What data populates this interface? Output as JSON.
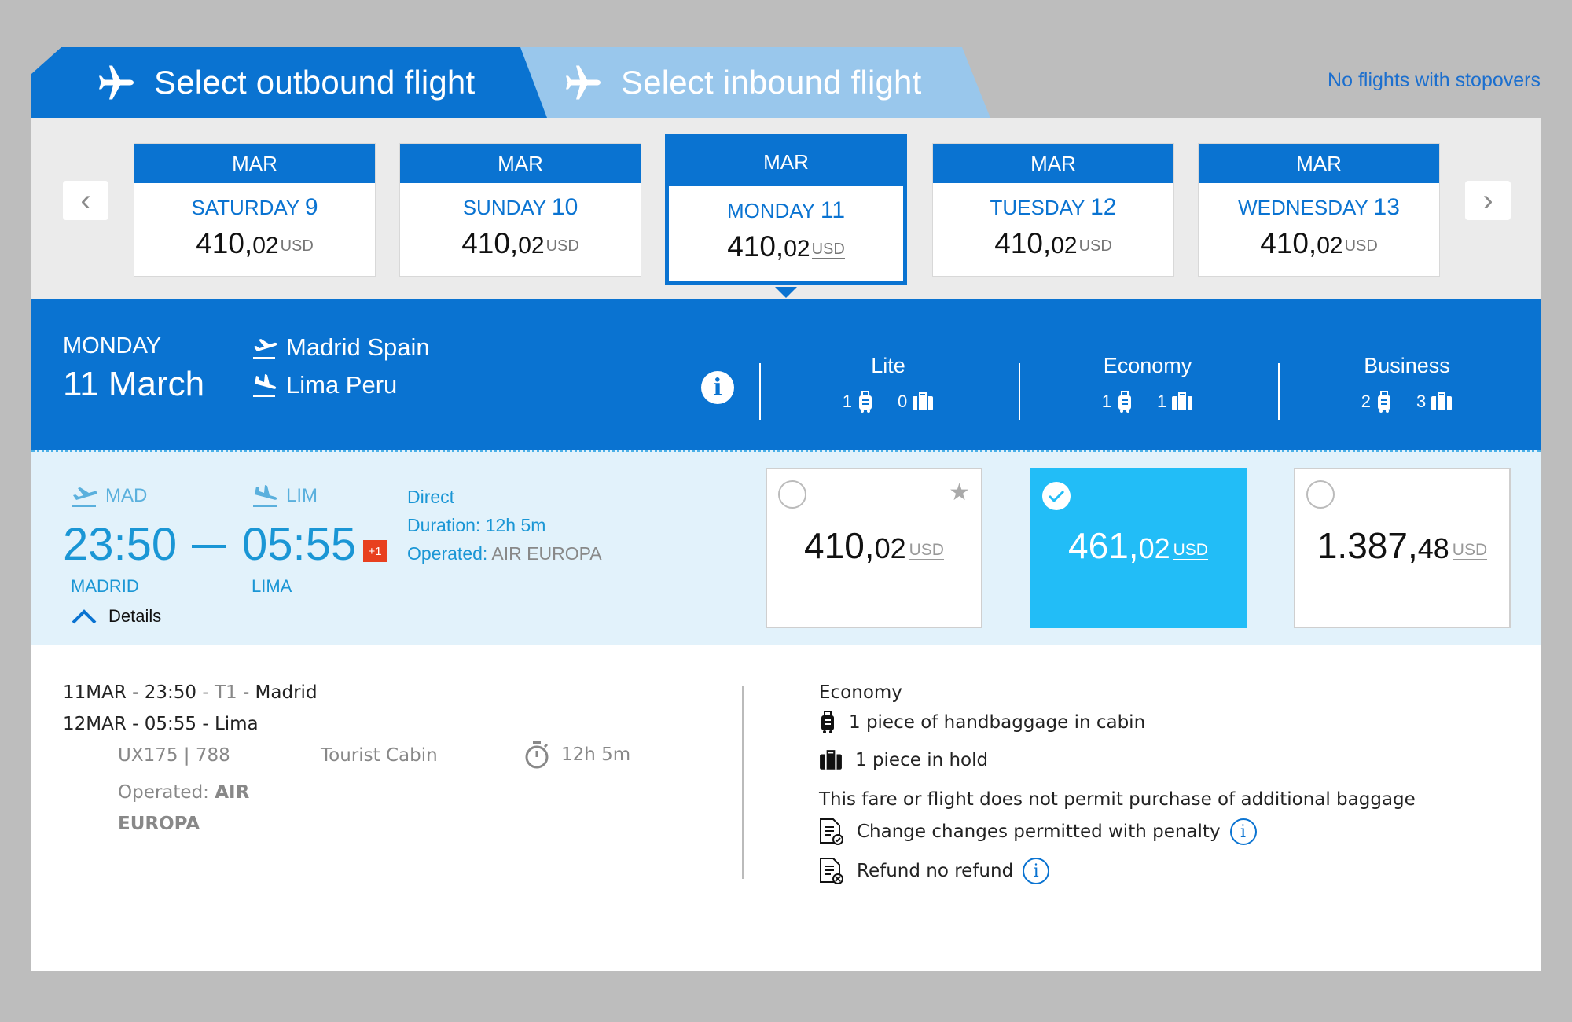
{
  "tabs": {
    "outbound_label": "Select outbound flight",
    "inbound_label": "Select inbound flight"
  },
  "stopovers_link": "No flights with stopovers",
  "dates": [
    {
      "month": "MAR",
      "day": "SATURDAY",
      "num": "9",
      "price_int": "410,",
      "price_dec": "02",
      "currency": "USD"
    },
    {
      "month": "MAR",
      "day": "SUNDAY",
      "num": "10",
      "price_int": "410,",
      "price_dec": "02",
      "currency": "USD"
    },
    {
      "month": "MAR",
      "day": "MONDAY",
      "num": "11",
      "price_int": "410,",
      "price_dec": "02",
      "currency": "USD",
      "selected": true
    },
    {
      "month": "MAR",
      "day": "TUESDAY",
      "num": "12",
      "price_int": "410,",
      "price_dec": "02",
      "currency": "USD"
    },
    {
      "month": "MAR",
      "day": "WEDNESDAY",
      "num": "13",
      "price_int": "410,",
      "price_dec": "02",
      "currency": "USD"
    }
  ],
  "summary": {
    "dayname": "MONDAY",
    "date": "11 March",
    "from": "Madrid Spain",
    "to": "Lima Peru"
  },
  "fares": [
    {
      "name": "Lite",
      "hand": "1",
      "hold": "0"
    },
    {
      "name": "Economy",
      "hand": "1",
      "hold": "1"
    },
    {
      "name": "Business",
      "hand": "2",
      "hold": "3"
    }
  ],
  "flight": {
    "dep_code": "MAD",
    "arr_code": "LIM",
    "dep_time": "23:50",
    "arr_time": "05:55",
    "day_offset": "+1",
    "dep_city": "MADRID",
    "arr_city": "LIMA",
    "details_label": "Details",
    "direct": "Direct",
    "duration_label": "Duration:",
    "duration": "12h 5m",
    "operated_label": "Operated:",
    "operator": "AIR EUROPA"
  },
  "prices": [
    {
      "int": "410,",
      "dec": "02",
      "currency": "USD",
      "selected": false
    },
    {
      "int": "461,",
      "dec": "02",
      "currency": "USD",
      "selected": true
    },
    {
      "int": "1.387,",
      "dec": "48",
      "currency": "USD",
      "selected": false
    }
  ],
  "details": {
    "dep_date": "11MAR - 23:50",
    "dep_sep": " - ",
    "dep_terminal": "T1",
    "dep_city": " - Madrid",
    "arr_line": "12MAR - 05:55 - Lima",
    "flight_no": "UX175 | 788",
    "cabin": "Tourist Cabin",
    "duration": "12h 5m",
    "operated_label": "Operated: ",
    "operator": "AIR EUROPA",
    "fare_name": "Economy",
    "handbaggage": "1 piece of handbaggage in cabin",
    "hold": "1 piece in hold",
    "no_additional": "This fare or flight does not permit purchase of additional baggage",
    "change": "Change changes permitted with penalty",
    "refund": "Refund no refund"
  },
  "colors": {
    "brand_blue": "#0a73d1",
    "light_tab": "#99c7ec",
    "selected_fare": "#22bdf7",
    "accent_orange": "#e8401f"
  }
}
